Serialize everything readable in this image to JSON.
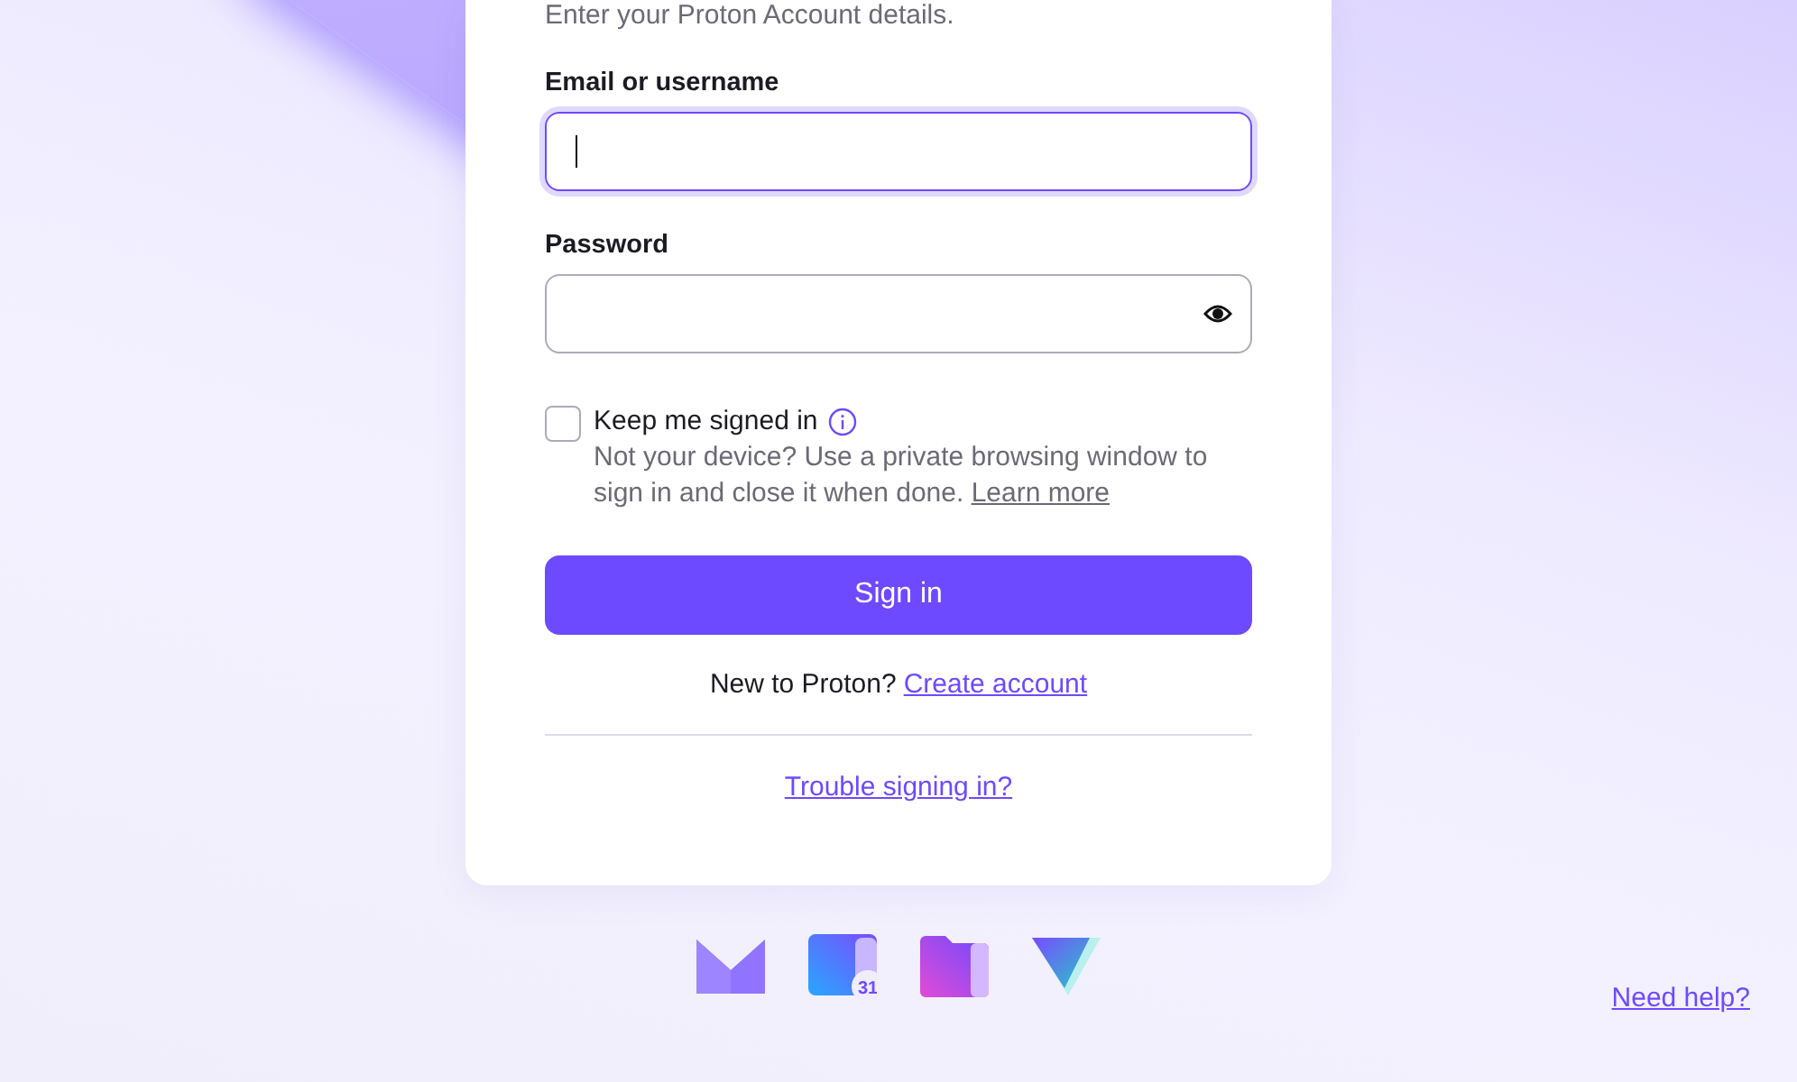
{
  "card": {
    "subtitle": "Enter your Proton Account details.",
    "fields": [
      {
        "label": "Email or username",
        "kind": "text",
        "focused": true
      },
      {
        "label": "Password",
        "kind": "password",
        "focused": false
      }
    ],
    "keep_signed_in": {
      "label": "Keep me signed in",
      "checked": false,
      "hint": "Not your device? Use a private browsing window to sign in and close it when done.",
      "hint_link": "Learn more"
    },
    "sign_in_button": "Sign in",
    "signup": {
      "text": "New to Proton?",
      "link": "Create account"
    },
    "trouble_link": "Trouble signing in?"
  },
  "apps": [
    {
      "kind": "mail"
    },
    {
      "kind": "calendar",
      "badge": "31"
    },
    {
      "kind": "drive"
    },
    {
      "kind": "vpn"
    }
  ],
  "help_link": "Need help?"
}
